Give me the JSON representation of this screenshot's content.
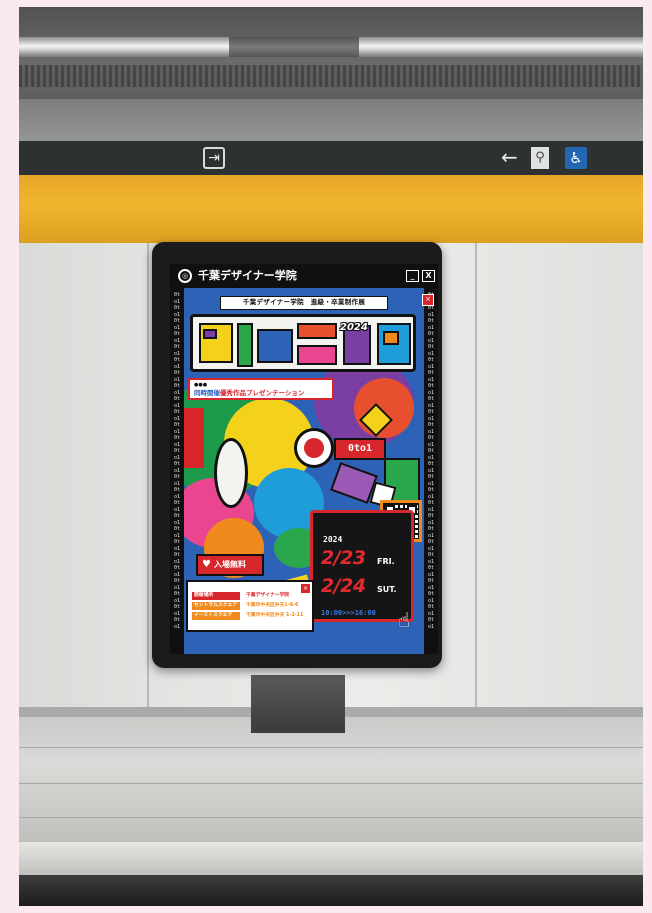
{
  "poster": {
    "school_name": "千葉デザイナー学院",
    "window_controls": [
      "_",
      "X"
    ],
    "side_strip_text": "0to1 0to1 0to1 0to1 0to1 0to1 0to1 0to1 0to1 0to1 0to1 0to1 0to1 0to1 0to1 0to1 0to1 0to1 0to1 0to1 0to1 0to1 0to1 0to1 0to1 0to1",
    "subtitle": "千葉デザイナー学院　進級・卒業制作展",
    "year": "2024",
    "presentation_prefix": "同時開催",
    "presentation_label": "優秀作品プレゼンテーション",
    "theme": "0to1",
    "date_year": "2024",
    "date_1": "2/23",
    "day_1": "FRI.",
    "date_2": "2/24",
    "day_2": "SUT.",
    "time_range": "10:00>>>16:00",
    "free_entry": "入場無料",
    "venue_header": "開催場所",
    "venues": [
      {
        "name": "千葉デザイナー学院",
        "address": ""
      },
      {
        "name": "セントラルスクエア",
        "address": "千葉市中央区弁天1-8-6"
      },
      {
        "name": "イーストスクエア",
        "address": "千葉市中央区弁天 1-2-11"
      }
    ]
  },
  "colors": {
    "accent_red": "#d8272c",
    "accent_blue": "#2d63b7",
    "accent_orange": "#f08a1c",
    "station_yellow": "#f1b52e"
  },
  "icons": [
    "exit-icon",
    "arrow-left-icon",
    "restroom-icon",
    "wheelchair-icon",
    "heart-icon",
    "pointer-hand-icon",
    "qr-code-icon"
  ]
}
